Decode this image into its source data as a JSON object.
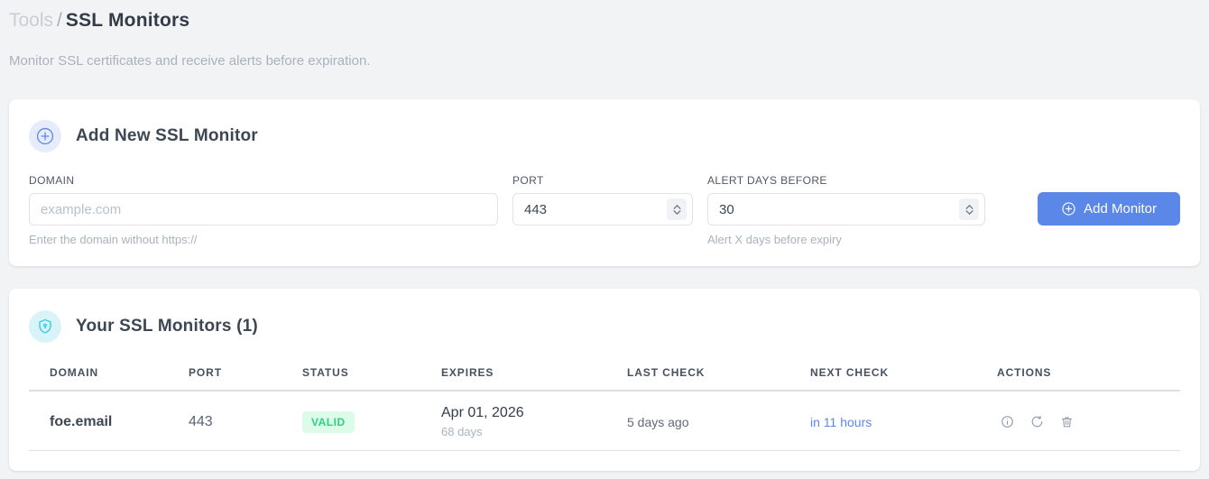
{
  "breadcrumb": {
    "parent": "Tools",
    "separator": "/",
    "current": "SSL Monitors"
  },
  "page_subtitle": "Monitor SSL certificates and receive alerts before expiration.",
  "add_card": {
    "title": "Add New SSL Monitor",
    "title_icon": "plus-circle-icon",
    "domain_field": {
      "label": "DOMAIN",
      "placeholder": "example.com",
      "helper": "Enter the domain without https://"
    },
    "port_field": {
      "label": "PORT",
      "value": "443"
    },
    "alert_field": {
      "label": "ALERT DAYS BEFORE",
      "value": "30",
      "helper": "Alert X days before expiry"
    },
    "submit_button": {
      "label": "Add Monitor",
      "icon": "plus-circle-icon"
    }
  },
  "monitors_card": {
    "title": "Your SSL Monitors (1)",
    "title_icon": "shield-icon",
    "table": {
      "headers": [
        "DOMAIN",
        "PORT",
        "STATUS",
        "EXPIRES",
        "LAST CHECK",
        "NEXT CHECK",
        "ACTIONS"
      ],
      "rows": [
        {
          "domain": "foe.email",
          "port": "443",
          "status": "VALID",
          "expires_date": "Apr 01, 2026",
          "expires_in": "68 days",
          "last_check": "5 days ago",
          "next_check": "in 11 hours",
          "action_icons": [
            "info-icon",
            "refresh-icon",
            "trash-icon"
          ]
        }
      ]
    }
  },
  "colors": {
    "page_background": "#f2f3f5",
    "accent_blue": "#5b87e8",
    "accent_cyan": "#3ecde4",
    "status_valid_bg": "#dcfbe9",
    "status_valid_text": "#2bd381",
    "link_blue": "#5b87e8"
  }
}
